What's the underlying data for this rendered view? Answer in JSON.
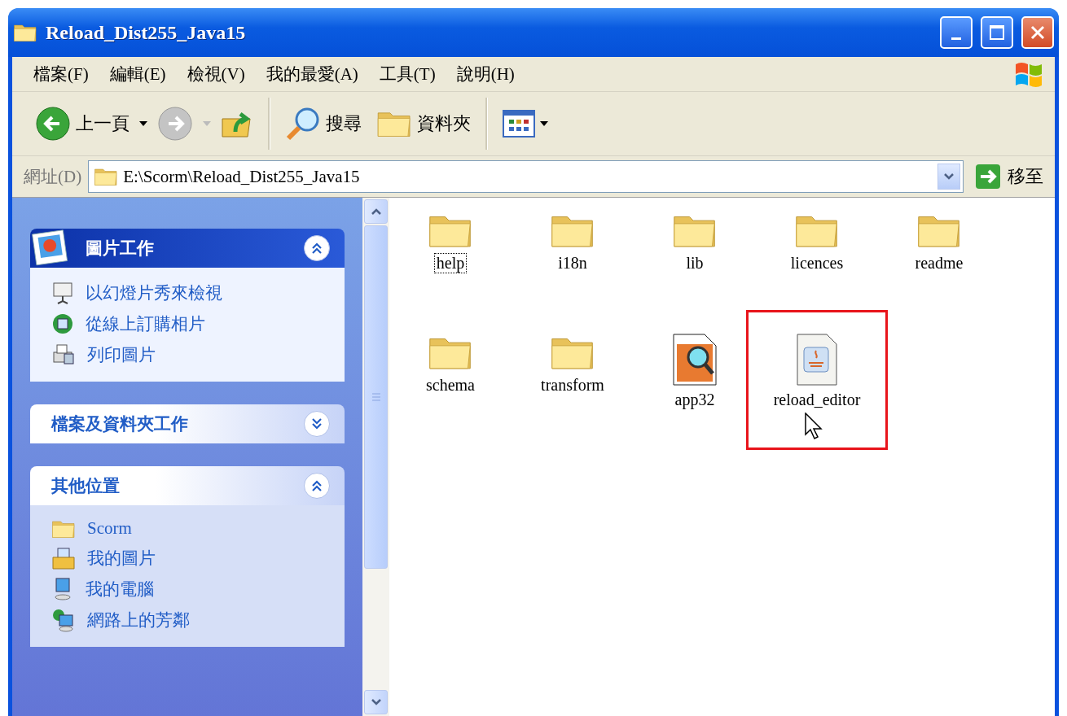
{
  "window": {
    "title": "Reload_Dist255_Java15"
  },
  "menu": [
    "檔案(F)",
    "編輯(E)",
    "檢視(V)",
    "我的最愛(A)",
    "工具(T)",
    "說明(H)"
  ],
  "toolbar": {
    "back": {
      "label": "上一頁",
      "disabled": false
    },
    "forward": {
      "disabled": true
    },
    "search": "搜尋",
    "folders": "資料夾"
  },
  "address": {
    "label": "網址(D)",
    "value": "E:\\Scorm\\Reload_Dist255_Java15",
    "go": "移至"
  },
  "sidebar": [
    {
      "title": "圖片工作",
      "kind": "special",
      "expanded": true,
      "items": [
        {
          "label": "以幻燈片秀來檢視",
          "kind": "slideshow"
        },
        {
          "label": "從線上訂購相片",
          "kind": "globe"
        },
        {
          "label": "列印圖片",
          "kind": "printer"
        }
      ]
    },
    {
      "title": "檔案及資料夾工作",
      "kind": "normal",
      "expanded": false
    },
    {
      "title": "其他位置",
      "kind": "normal",
      "expanded": true,
      "items": [
        {
          "label": "Scorm",
          "kind": "folder"
        },
        {
          "label": "我的圖片",
          "kind": "pictures"
        },
        {
          "label": "我的電腦",
          "kind": "computer"
        },
        {
          "label": "網路上的芳鄰",
          "kind": "network"
        }
      ]
    }
  ],
  "files": [
    {
      "name": "help",
      "kind": "folder",
      "focused": true,
      "highlighted": false
    },
    {
      "name": "i18n",
      "kind": "folder",
      "focused": false,
      "highlighted": false
    },
    {
      "name": "lib",
      "kind": "folder",
      "focused": false,
      "highlighted": false
    },
    {
      "name": "licences",
      "kind": "folder",
      "focused": false,
      "highlighted": false
    },
    {
      "name": "readme",
      "kind": "folder",
      "focused": false,
      "highlighted": false
    },
    {
      "name": "schema",
      "kind": "folder",
      "focused": false,
      "highlighted": false
    },
    {
      "name": "transform",
      "kind": "folder",
      "focused": false,
      "highlighted": false
    },
    {
      "name": "app32",
      "kind": "app",
      "focused": false,
      "highlighted": false
    },
    {
      "name": "reload_editor",
      "kind": "java",
      "focused": false,
      "highlighted": true
    }
  ]
}
